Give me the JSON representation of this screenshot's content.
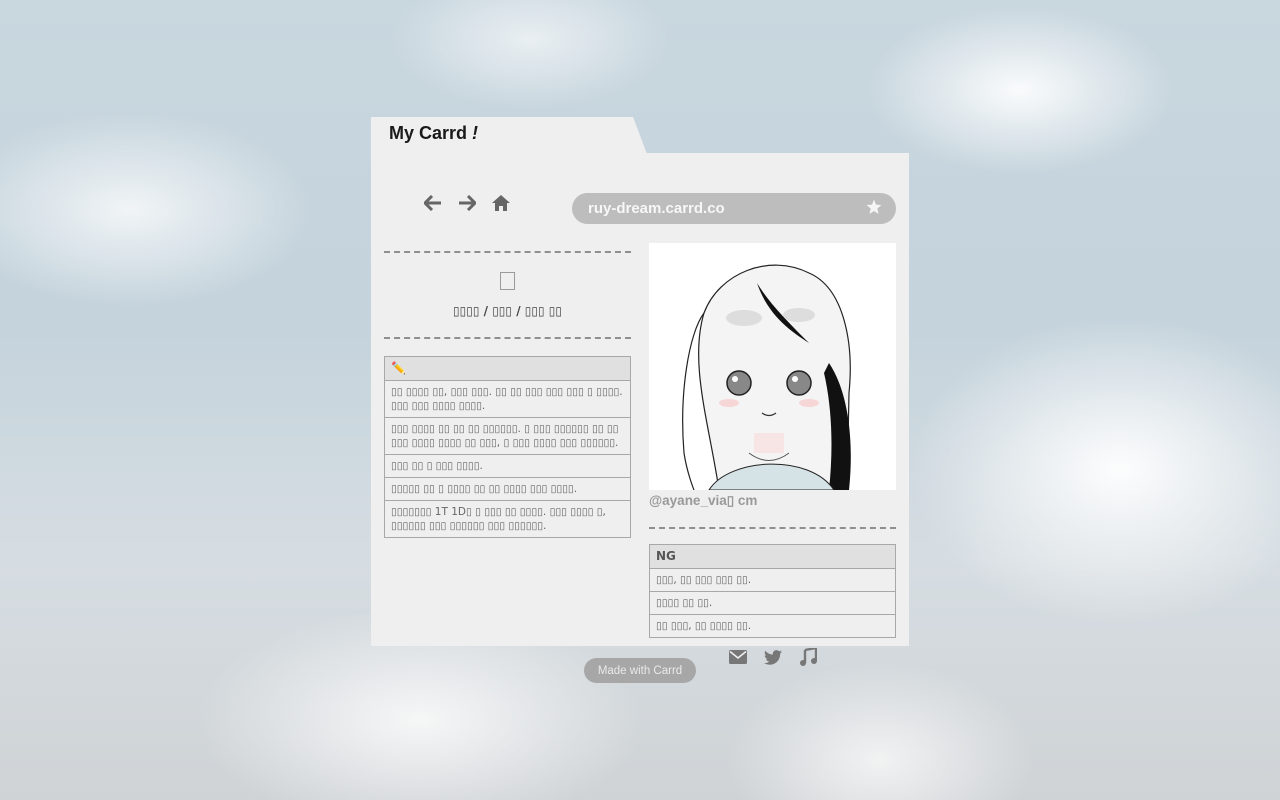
{
  "window": {
    "tab_title": "My Carrd",
    "tab_title_suffix": "!",
    "url": "ruy-dream.carrd.co"
  },
  "nav": {
    "icons": [
      "back-arrow-icon",
      "forward-arrow-icon",
      "home-icon"
    ],
    "bookmark_icon": "star-icon"
  },
  "left": {
    "emoji_glyph": "▯",
    "subtitle": "▯▯▯▯ / ▯▯▯ / ▯▯▯ ▯▯",
    "table_header": "✏️",
    "rows": [
      "▯▯ ▯▯▯▯ ▯▯, ▯▯▯ ▯▯▯. ▯▯ ▯▯ ▯▯▯ ▯▯▯ ▯▯▯ ▯ ▯▯▯▯. ▯▯▯ ▯▯▯ ▯▯▯▯ ▯▯▯▯.",
      "▯▯▯ ▯▯▯▯ ▯▯ ▯▯ ▯▯ ▯▯▯▯▯▯. ▯ ▯▯▯ ▯▯▯▯▯▯ ▯▯ ▯▯ ▯▯▯ ▯▯▯▯ ▯▯▯▯ ▯▯ ▯▯▯, ▯ ▯▯▯ ▯▯▯▯ ▯▯▯ ▯▯▯▯▯▯.",
      "▯▯▯ ▯▯ ▯ ▯▯▯ ▯▯▯▯.",
      "▯▯▯▯▯ ▯▯ ▯ ▯▯▯▯ ▯▯ ▯▯ ▯▯▯▯ ▯▯▯ ▯▯▯▯.",
      "▯▯▯▯▯▯▯ 1T 1D▯ ▯ ▯▯▯ ▯▯ ▯▯▯▯. ▯▯▯ ▯▯▯▯ ▯, ▯▯▯▯▯▯ ▯▯▯ ▯▯▯▯▯▯ ▯▯▯ ▯▯▯▯▯▯."
    ]
  },
  "right": {
    "avatar_alt": "avatar illustration",
    "handle": "@ayane_via▯ cm",
    "table_header": "NG",
    "rows": [
      "▯▯▯, ▯▯ ▯▯▯ ▯▯▯ ▯▯.",
      "▯▯▯▯ ▯▯ ▯▯.",
      "▯▯ ▯▯▯, ▯▯ ▯▯▯▯ ▯▯."
    ],
    "social_icons": [
      "mail-icon",
      "twitter-icon",
      "music-icon"
    ]
  },
  "footer": {
    "made_with": "Made with Carrd"
  },
  "colors": {
    "panel": "#efefef",
    "urlbar": "#bdbdbd",
    "badge": "#a7a7a7"
  }
}
